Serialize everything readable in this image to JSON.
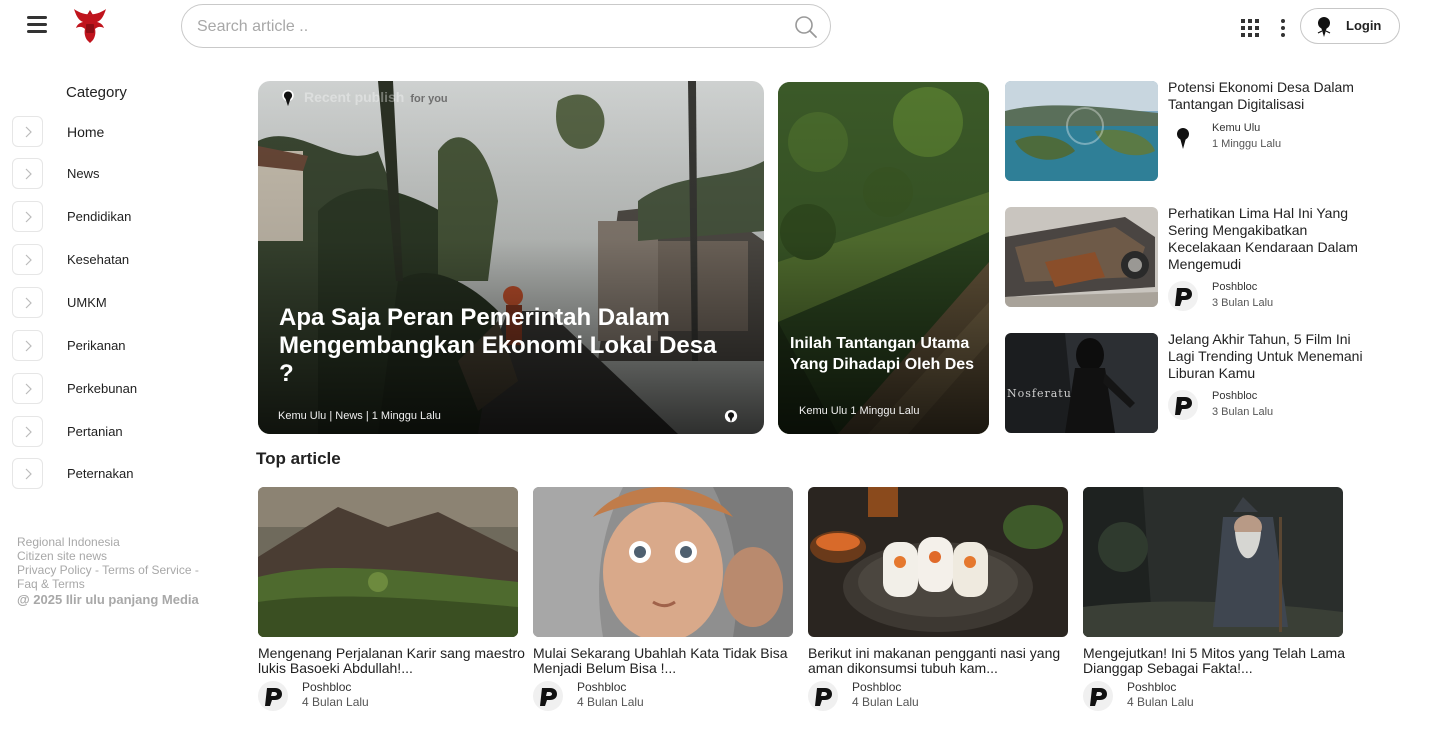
{
  "header": {
    "search_placeholder": "Search article ..",
    "login_label": "Login"
  },
  "sidebar": {
    "title": "Category",
    "items": [
      {
        "label": "Home"
      },
      {
        "label": "News"
      },
      {
        "label": "Pendidikan"
      },
      {
        "label": "Kesehatan"
      },
      {
        "label": "UMKM"
      },
      {
        "label": "Perikanan"
      },
      {
        "label": "Perkebunan"
      },
      {
        "label": "Pertanian"
      },
      {
        "label": "Peternakan"
      }
    ],
    "footer": {
      "line1": "Regional Indonesia",
      "line2": "Citizen site news",
      "privacy": "Privacy Policy",
      "sep": " - ",
      "terms": "Terms of Service",
      "sep2": " -",
      "faq": "Faq & Terms",
      "copyright": "@ 2025 Ilir ulu panjang Media"
    }
  },
  "hero": {
    "recent_label": "Recent publish",
    "for_you": "for you",
    "main": {
      "title": "Apa Saja Peran Pemerintah Dalam Mengembangkan Ekonomi Lokal Desa ?",
      "meta": "Kemu Ulu | News | 1 Minggu Lalu"
    },
    "second": {
      "title": "Inilah Tantangan Utama Yang Dihadapi Oleh Des",
      "meta": "Kemu Ulu 1 Minggu Lalu"
    }
  },
  "side_list": [
    {
      "title": "Potensi Ekonomi Desa Dalam Tantangan Digitalisasi",
      "author": "Kemu Ulu",
      "time": "1 Minggu Lalu"
    },
    {
      "title": "Perhatikan Lima Hal Ini Yang Sering Mengakibatkan Kecelakaan Kendaraan Dalam Mengemudi",
      "author": "Poshbloc",
      "time": "3 Bulan Lalu"
    },
    {
      "title": "Jelang Akhir Tahun, 5 Film Ini Lagi Trending Untuk Menemani Liburan Kamu",
      "author": "Poshbloc",
      "time": "3 Bulan Lalu",
      "thumb_text": "Nosferatu"
    }
  ],
  "top_article": {
    "heading": "Top article",
    "items": [
      {
        "title": "Mengenang Perjalanan Karir sang maestro lukis Basoeki Abdullah!...",
        "author": "Poshbloc",
        "time": "4 Bulan Lalu"
      },
      {
        "title": "Mulai Sekarang Ubahlah Kata Tidak Bisa Menjadi Belum Bisa !...",
        "author": "Poshbloc",
        "time": "4 Bulan Lalu"
      },
      {
        "title": "Berikut ini makanan pengganti nasi yang aman dikonsumsi tubuh kam...",
        "author": "Poshbloc",
        "time": "4 Bulan Lalu"
      },
      {
        "title": "Mengejutkan! Ini 5 Mitos yang Telah Lama Dianggap Sebagai Fakta!...",
        "author": "Poshbloc",
        "time": "4 Bulan Lalu"
      }
    ]
  }
}
